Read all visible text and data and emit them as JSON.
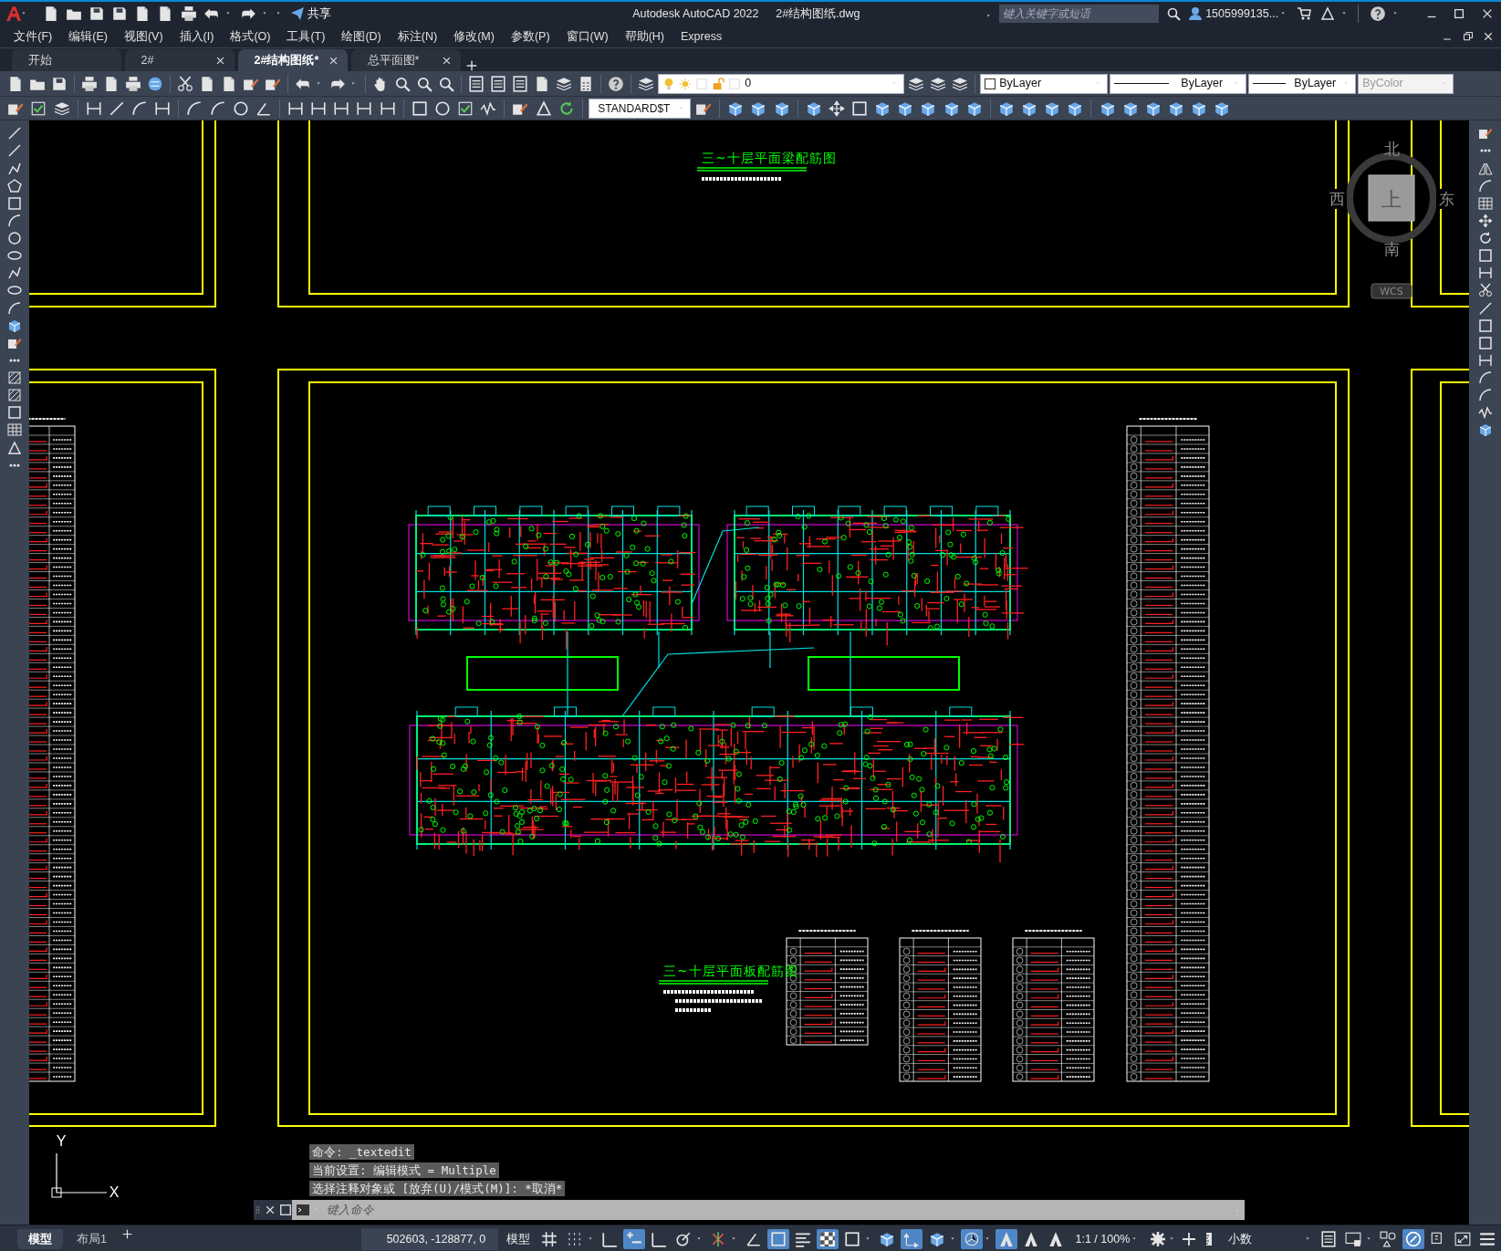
{
  "window": {
    "app_title": "Autodesk AutoCAD 2022",
    "file_title": "2#结构图纸.dwg",
    "share": "共享",
    "search": {
      "placeholder": "键入关键字或短语"
    },
    "user": "1505999135..."
  },
  "menu": [
    "文件(F)",
    "编辑(E)",
    "视图(V)",
    "插入(I)",
    "格式(O)",
    "工具(T)",
    "绘图(D)",
    "标注(N)",
    "修改(M)",
    "参数(P)",
    "窗口(W)",
    "帮助(H)",
    "Express"
  ],
  "tabs": [
    {
      "label": "开始",
      "selected": false,
      "closable": false
    },
    {
      "label": "2#",
      "selected": false,
      "closable": true
    },
    {
      "label": "2#结构图纸*",
      "selected": true,
      "closable": true
    },
    {
      "label": "总平面图*",
      "selected": false,
      "closable": true
    }
  ],
  "layer": {
    "name": "0"
  },
  "properties": [
    {
      "kind": "color",
      "label": "ByLayer",
      "disabled": false
    },
    {
      "kind": "linetype",
      "label": "ByLayer",
      "disabled": false
    },
    {
      "kind": "lineweight",
      "label": "ByLayer",
      "disabled": false
    },
    {
      "kind": "plotstyle",
      "label": "ByColor",
      "disabled": true
    }
  ],
  "text_style": "STANDARD$T",
  "viewcube": {
    "north": "北",
    "west": "西",
    "east": "东",
    "south": "南",
    "top": "上",
    "wcs": "WCS"
  },
  "drawing_titles": [
    "三~十层平面梁配筋图",
    "三~十层平面板配筋图"
  ],
  "ucs": {
    "y": "Y",
    "x": "X"
  },
  "command_history": [
    "命令: _textedit",
    "当前设置: 编辑模式 = Multiple",
    "选择注释对象或 [放弃(U)/模式(M)]: *取消*"
  ],
  "command_line": {
    "placeholder": "键入命令"
  },
  "layout_tabs": [
    {
      "label": "模型",
      "selected": true
    },
    {
      "label": "布局1",
      "selected": false
    }
  ],
  "status_bar": {
    "coordinates": "502603, -128877, 0",
    "space": "模型",
    "toggles": [
      {
        "on": false
      },
      {
        "on": false
      },
      {
        "on": false
      },
      {
        "on": true
      },
      {
        "on": false
      },
      {
        "on": false
      },
      {
        "on": false
      },
      {
        "on": false
      },
      {
        "on": true
      },
      {
        "on": false
      },
      {
        "on": true
      },
      {
        "on": false
      },
      {
        "on": false
      },
      {
        "on": true
      },
      {
        "on": false
      },
      {
        "on": true
      },
      {
        "on": true
      },
      {
        "on": false
      },
      {
        "on": false
      }
    ],
    "scale": "1:1 / 100%",
    "units": "小数",
    "toggles_right": [
      {
        "on": false
      },
      {
        "on": false
      },
      {
        "on": false
      },
      {
        "on": true
      },
      {
        "on": false
      },
      {
        "on": false
      },
      {
        "on": false
      }
    ]
  }
}
